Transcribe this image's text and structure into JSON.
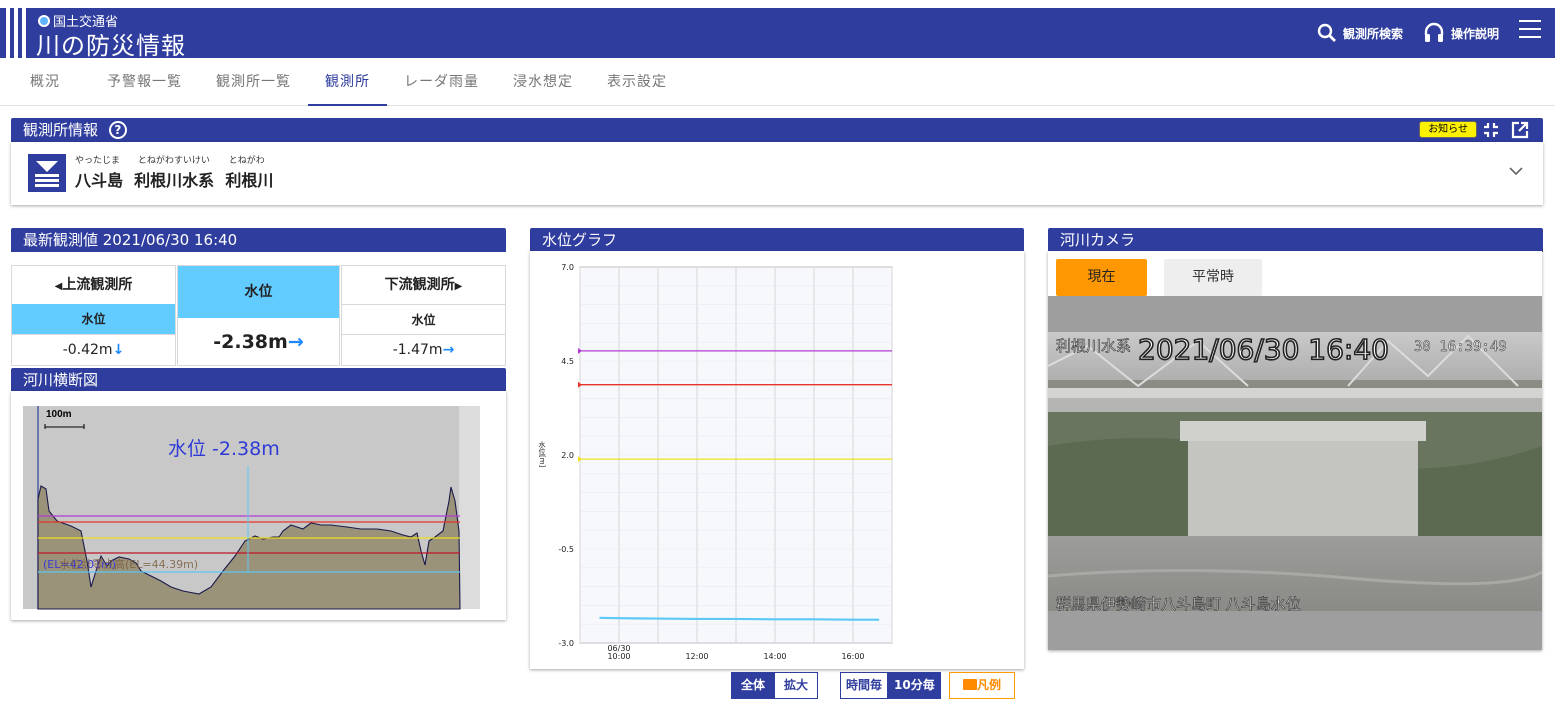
{
  "header": {
    "ministry": "国土交通省",
    "app_title": "川の防災情報",
    "station_search": "観測所検索",
    "help": "操作説明"
  },
  "tabs": [
    "概況",
    "予警報一覧",
    "観測所一覧",
    "観測所",
    "レーダ雨量",
    "浸水想定",
    "表示設定"
  ],
  "active_tab": "観測所",
  "station": {
    "section_title": "観測所情報",
    "help_mark": "?",
    "notice": "お知らせ",
    "ruby": [
      "やったじま",
      "とねがわすいけい",
      "とねがわ"
    ],
    "names": [
      "八斗島",
      "利根川水系",
      "利根川"
    ]
  },
  "latest": {
    "title": "最新観測値 2021/06/30 16:40",
    "upstream": {
      "label": "上流観測所",
      "metric": "水位",
      "value": "-0.42m",
      "trend": "down"
    },
    "current": {
      "label": "水位",
      "value": "-2.38m",
      "trend": "flat"
    },
    "downstream": {
      "label": "下流観測所",
      "metric": "水位",
      "value": "-1.47m",
      "trend": "flat"
    }
  },
  "cross_section": {
    "title": "河川横断図",
    "scale": "100m",
    "water_level_label": "水位 -2.38m",
    "el_label": "(EL=42.01m)",
    "zero_label": "水位計零点高(EL=44.39m)"
  },
  "graph": {
    "title": "水位グラフ",
    "controls_a": [
      "全体",
      "拡大"
    ],
    "controls_b": [
      "時間毎",
      "10分毎"
    ],
    "legend_btn": "凡例",
    "chart_data": {
      "type": "line",
      "ylabel": "水位[m]",
      "ylim": [
        -3.0,
        7.0
      ],
      "yticks": [
        "7.0",
        "4.5",
        "2.0",
        "-0.5",
        "-3.0"
      ],
      "xticks": [
        "06/30\n10:00",
        "12:00",
        "14:00",
        "16:00"
      ],
      "grid": true,
      "reference_lines": [
        {
          "level": 4.77,
          "color": "#b23bd4"
        },
        {
          "level": 3.87,
          "color": "#e8332a"
        },
        {
          "level": 1.89,
          "color": "#f0e020"
        }
      ],
      "series": [
        {
          "x": [
            9.5,
            10,
            11,
            12,
            13,
            14,
            15,
            16,
            16.67
          ],
          "values": [
            -2.33,
            -2.34,
            -2.35,
            -2.36,
            -2.36,
            -2.37,
            -2.37,
            -2.38,
            -2.38
          ],
          "color": "#5bc8f5"
        }
      ]
    }
  },
  "camera": {
    "title": "河川カメラ",
    "tab_now": "現在",
    "tab_normal": "平常時",
    "overlay_time": "2021/06/30 16:40",
    "overlay_top_left": "利根川水系",
    "overlay_top_right": "30 16:39:49",
    "overlay_bottom": "群馬県伊勢崎市八斗島町  八斗島水位"
  }
}
